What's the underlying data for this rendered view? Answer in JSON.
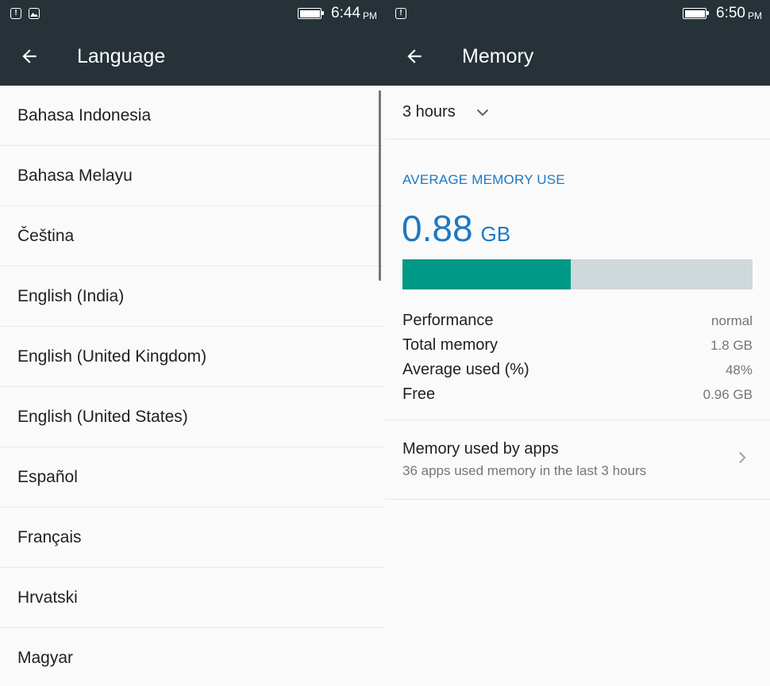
{
  "left": {
    "status": {
      "time": "6:44",
      "ampm": "PM",
      "icons": [
        "alert-icon",
        "image-icon"
      ]
    },
    "title": "Language",
    "languages": [
      "Bahasa Indonesia",
      "Bahasa Melayu",
      "Čeština",
      "English (India)",
      "English (United Kingdom)",
      "English (United States)",
      "Español",
      "Français",
      "Hrvatski",
      "Magyar"
    ]
  },
  "right": {
    "status": {
      "time": "6:50",
      "ampm": "PM",
      "icons": [
        "alert-icon"
      ]
    },
    "title": "Memory",
    "period": "3 hours",
    "section_heading": "AVERAGE MEMORY USE",
    "average_value": "0.88",
    "average_unit": "GB",
    "usage_fraction": 0.48,
    "stats": [
      {
        "label": "Performance",
        "value": "normal"
      },
      {
        "label": "Total memory",
        "value": "1.8 GB"
      },
      {
        "label": "Average used (%)",
        "value": "48%"
      },
      {
        "label": "Free",
        "value": "0.96 GB"
      }
    ],
    "apps": {
      "title": "Memory used by apps",
      "subtitle": "36 apps used memory in the last 3 hours"
    }
  },
  "colors": {
    "appbar": "#263238",
    "accent": "#1e78c2",
    "bar_fill": "#009886",
    "bar_track": "#cfd8da"
  }
}
